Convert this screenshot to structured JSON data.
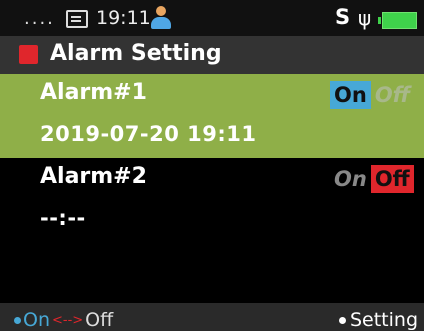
{
  "status_bar": {
    "dots": "....",
    "message_icon": "message-icon",
    "time": "19:11",
    "user_icon": "person-icon",
    "s_label": "S",
    "usb_icon": "usb-icon",
    "battery_icon": "battery-icon"
  },
  "title": {
    "icon": "red-square-icon",
    "text": "Alarm Setting"
  },
  "alarms": [
    {
      "label": "Alarm#1",
      "value": "2019-07-20 19:11",
      "on_label": "On",
      "off_label": "Off",
      "state": "On"
    },
    {
      "label": "Alarm#2",
      "value": "--:--",
      "on_label": "On",
      "off_label": "Off",
      "state": "Off"
    }
  ],
  "softkeys": {
    "left_on": "On",
    "left_arrow": "<-->",
    "left_off": "Off",
    "right": "Setting"
  },
  "colors": {
    "selected_row": "#8faf48",
    "on_active": "#47a8d6",
    "off_active": "#e0262c",
    "battery": "#3fd24b"
  }
}
